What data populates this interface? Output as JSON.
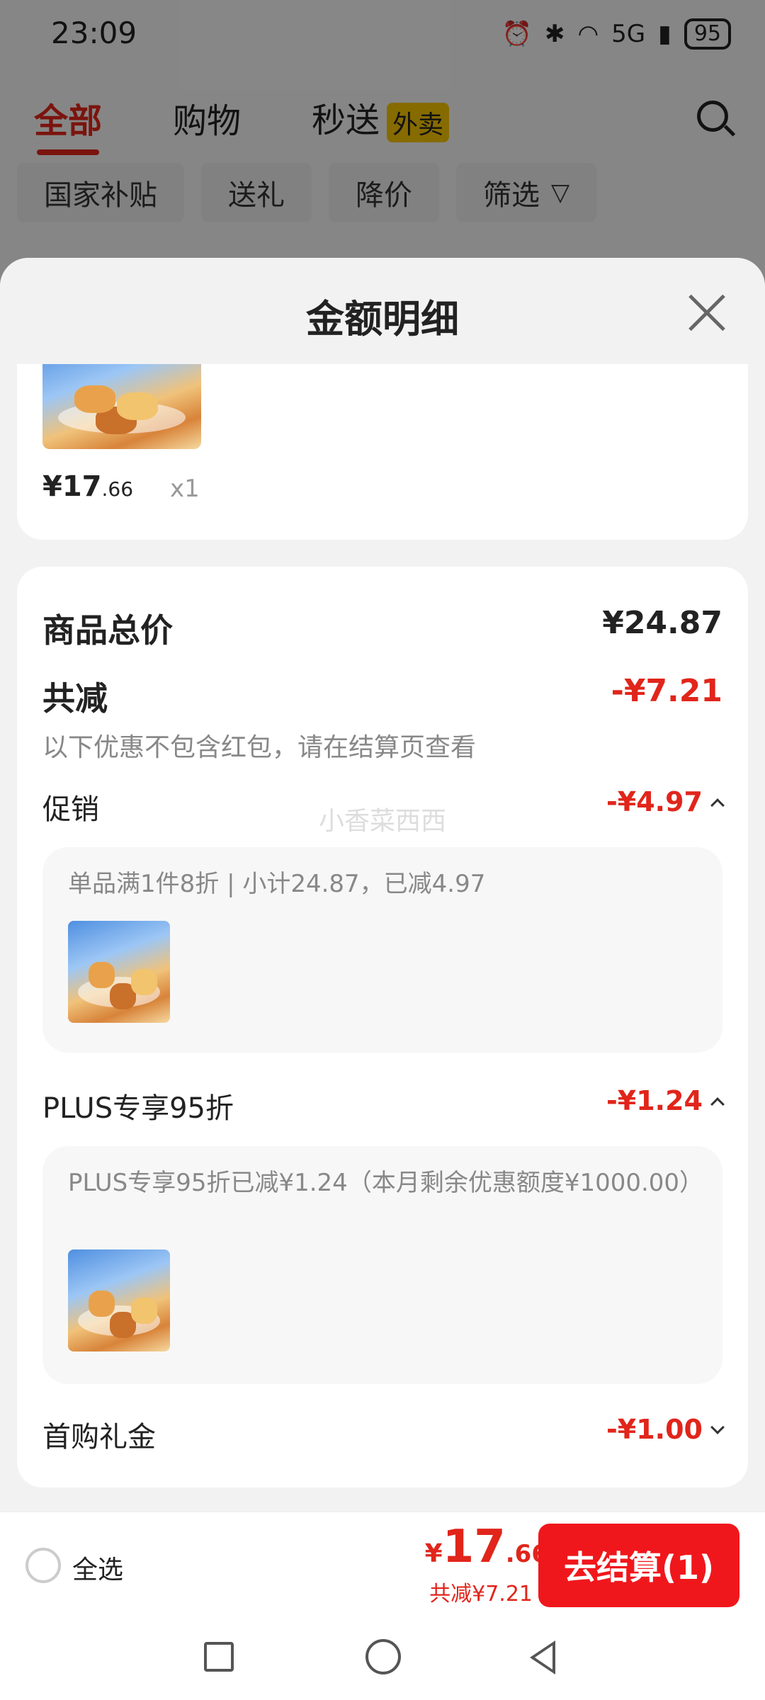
{
  "status_bar": {
    "time": "23:09",
    "icons": [
      "alarm-icon",
      "bluetooth-icon",
      "wifi-icon",
      "signal-icon"
    ],
    "network": "5G",
    "battery": "95"
  },
  "header": {
    "tabs": [
      {
        "label": "全部",
        "active": true
      },
      {
        "label": "购物",
        "active": false
      },
      {
        "label": "秒送",
        "active": false,
        "badge": "外卖"
      }
    ]
  },
  "filters": {
    "chips": [
      "国家补贴",
      "送礼",
      "降价",
      "筛选"
    ]
  },
  "sheet": {
    "title": "金额明细",
    "item": {
      "price_int": "¥17",
      "price_dec": ".66",
      "qty": "x1"
    },
    "goods_total_label": "商品总价",
    "goods_total_value": "¥24.87",
    "discount_label": "共减",
    "discount_value": "-¥7.21",
    "discount_note": "以下优惠不包含红包，请在结算页查看",
    "watermark": "小香菜西西",
    "promotions": [
      {
        "label": "促销",
        "value": "-¥4.97",
        "detail": "单品满1件8折 | 小计24.87，已减4.97"
      },
      {
        "label": "PLUS专享95折",
        "value": "-¥1.24",
        "detail": "PLUS专享95折已减¥1.24（本月剩余优惠额度¥1000.00）"
      },
      {
        "label": "首购礼金",
        "value": "-¥1.00"
      }
    ]
  },
  "bottom_bar": {
    "select_all": "全选",
    "total_yen": "¥",
    "total_int": "17",
    "total_dec": ".66",
    "saved": "共减¥7.21",
    "checkout": "去结算(1)"
  },
  "colors": {
    "accent": "#e1251b",
    "checkout": "#f0171c",
    "badge": "#f5c400"
  }
}
